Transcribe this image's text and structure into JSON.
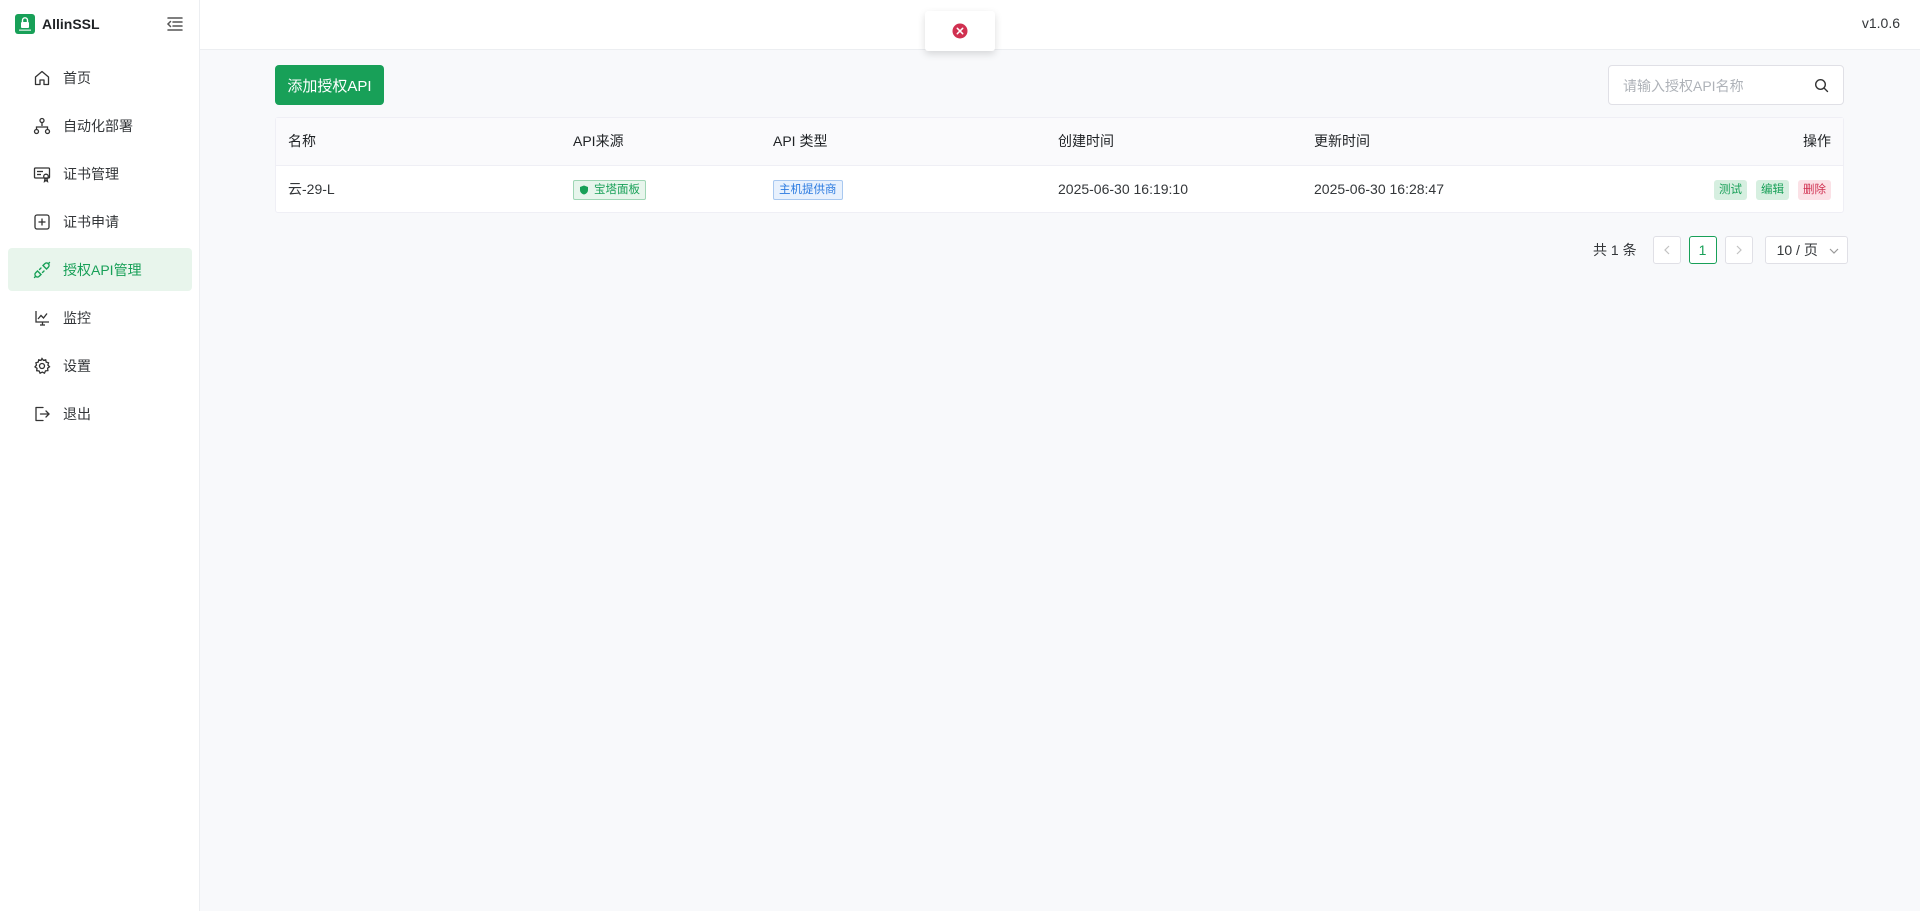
{
  "app": {
    "name": "AllinSSL",
    "version": "v1.0.6"
  },
  "sidebar": {
    "items": [
      {
        "label": "首页",
        "icon": "home-icon"
      },
      {
        "label": "自动化部署",
        "icon": "workflow-icon"
      },
      {
        "label": "证书管理",
        "icon": "certificate-icon"
      },
      {
        "label": "证书申请",
        "icon": "plus-square-icon"
      },
      {
        "label": "授权API管理",
        "icon": "api-link-icon",
        "active": true
      },
      {
        "label": "监控",
        "icon": "monitor-icon"
      },
      {
        "label": "设置",
        "icon": "gear-icon"
      },
      {
        "label": "退出",
        "icon": "logout-icon"
      }
    ]
  },
  "toolbar": {
    "add_label": "添加授权API",
    "search_placeholder": "请输入授权API名称"
  },
  "table": {
    "headers": [
      "名称",
      "API来源",
      "API 类型",
      "创建时间",
      "更新时间",
      "操作"
    ],
    "rows": [
      {
        "name": "云-29-L",
        "source": "宝塔面板",
        "type": "主机提供商",
        "created": "2025-06-30 16:19:10",
        "updated": "2025-06-30 16:28:47",
        "actions": [
          "测试",
          "编辑",
          "删除"
        ]
      }
    ]
  },
  "pagination": {
    "total_label": "共 1 条",
    "current_page": "1",
    "page_size": "10 / 页"
  },
  "colors": {
    "accent": "#18a058",
    "danger": "#d03050",
    "info": "#2c7be0"
  }
}
